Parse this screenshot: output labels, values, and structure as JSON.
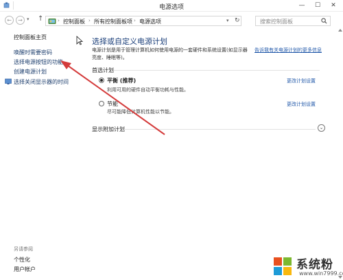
{
  "window": {
    "title": "电源选项",
    "min_glyph": "—",
    "max_glyph": "☐",
    "close_glyph": "✕"
  },
  "nav": {
    "back_glyph": "←",
    "forward_glyph": "→",
    "dropdown_glyph": "▾",
    "up_glyph": "↑",
    "breadcrumb": [
      "控制面板",
      "所有控制面板项",
      "电源选项"
    ],
    "chevron": "›",
    "refresh_glyph": "↻",
    "search_placeholder": "搜索控制面板"
  },
  "sidebar": {
    "home": "控制面板主页",
    "links": [
      "唤醒时需要密码",
      "选择电源按钮的功能",
      "创建电源计划",
      "选择关闭显示器的时间"
    ],
    "see_also": "另请参阅",
    "bottom_links": [
      "个性化",
      "用户帐户"
    ]
  },
  "main": {
    "heading": "选择或自定义电源计划",
    "description": "电源计划是用于管理计算机如何使用电源的一套硬件和系统设置(如显示器亮度、睡眠等)。",
    "desc_link": "告诉我有关电源计划的更多信息",
    "preferred_label": "首选计划",
    "plans": [
      {
        "name": "平衡 (推荐)",
        "desc": "利用可用的硬件自动平衡功耗与性能。",
        "change_link": "更改计划设置",
        "selected": true
      },
      {
        "name": "节能",
        "desc": "尽可能降低计算机性能以节能。",
        "change_link": "更改计划设置",
        "selected": false
      }
    ],
    "extra_label": "显示附加计划",
    "expand_glyph": "⌄"
  },
  "watermark": {
    "text": "系统粉",
    "url": "www.win7999.com"
  },
  "colors": {
    "heading": "#1a3e79",
    "link": "#1e56a8",
    "arrow": "#d43b3b"
  }
}
